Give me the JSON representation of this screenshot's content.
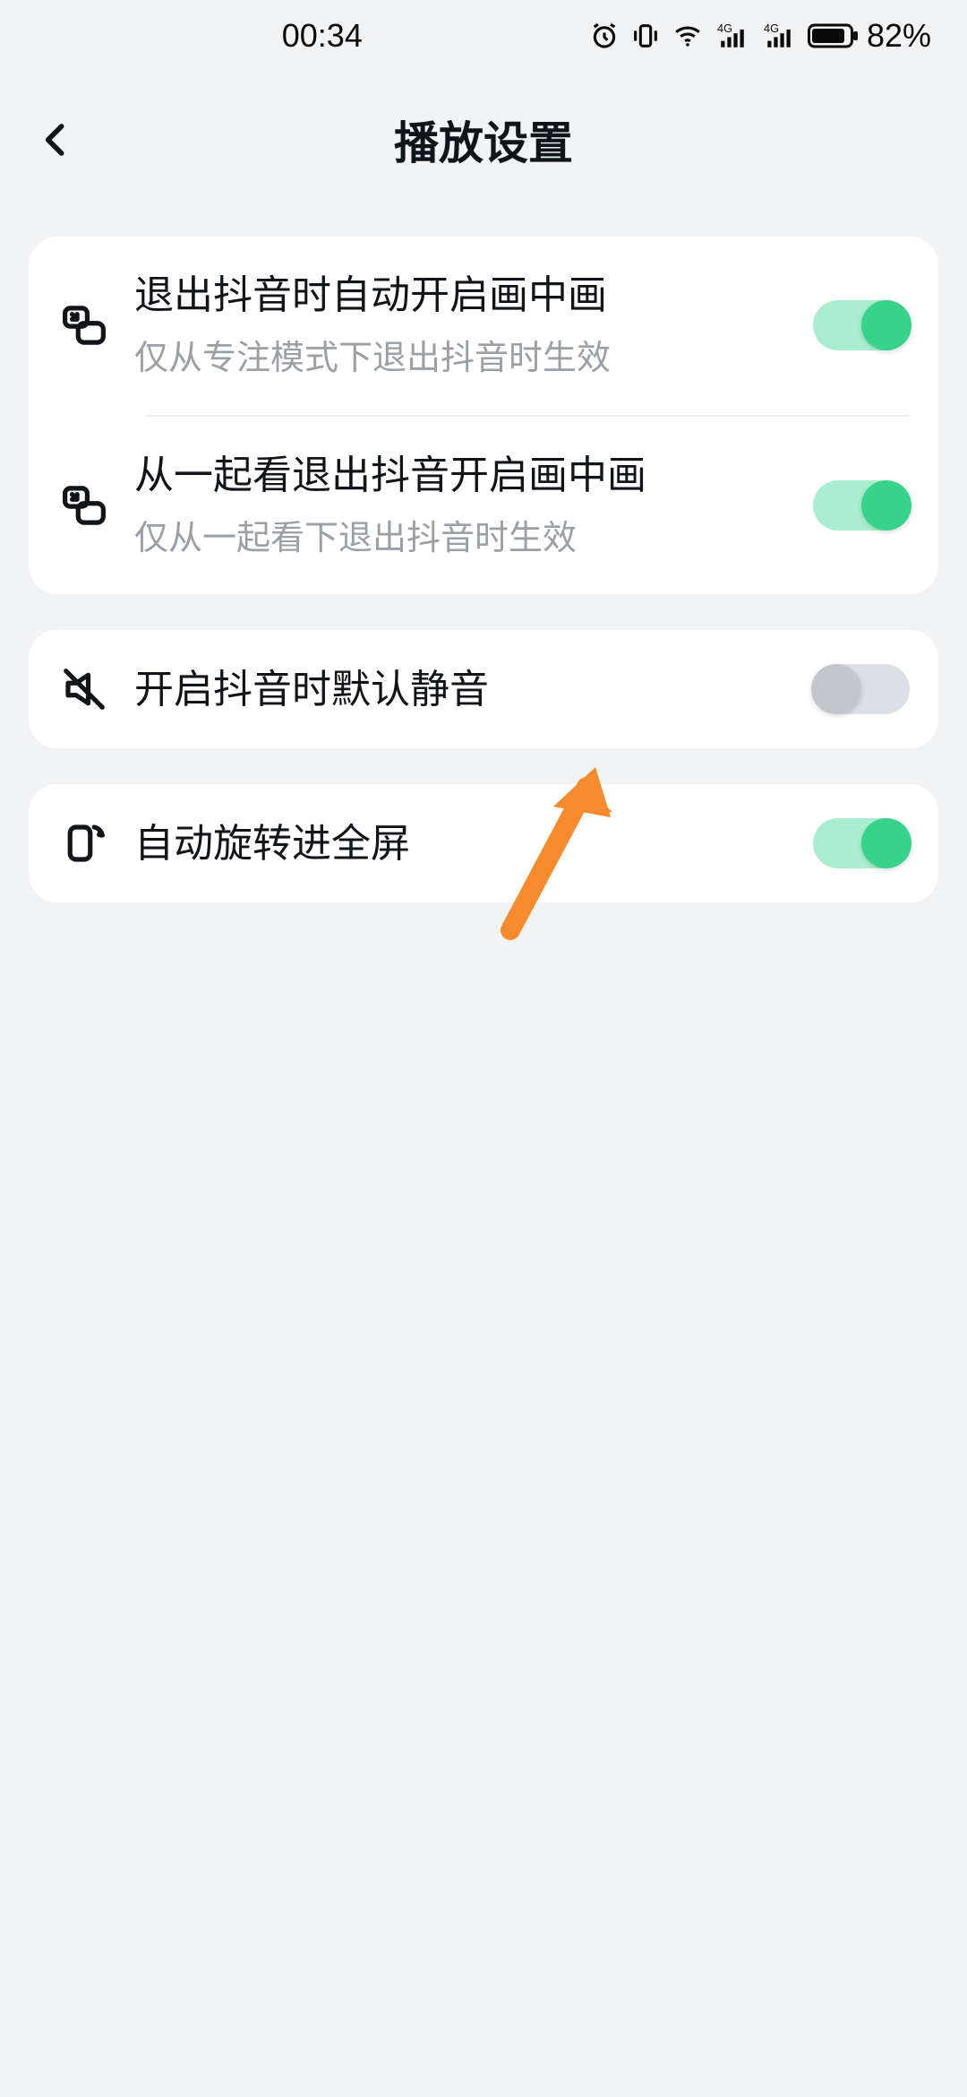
{
  "status": {
    "time": "00:34",
    "battery_text": "82%"
  },
  "header": {
    "title": "播放设置"
  },
  "groups": [
    {
      "rows": [
        {
          "id": "pip-on-exit",
          "icon": "pip-icon",
          "label": "退出抖音时自动开启画中画",
          "sub": "仅从专注模式下退出抖音时生效",
          "on": true
        },
        {
          "id": "pip-on-exit-watch-together",
          "icon": "pip-icon",
          "label": "从一起看退出抖音开启画中画",
          "sub": "仅从一起看下退出抖音时生效",
          "on": true
        }
      ]
    },
    {
      "rows": [
        {
          "id": "mute-on-launch",
          "icon": "mute-icon",
          "label": "开启抖音时默认静音",
          "on": false
        }
      ]
    },
    {
      "rows": [
        {
          "id": "auto-rotate-fullscreen",
          "icon": "rotate-icon",
          "label": "自动旋转进全屏",
          "on": true
        }
      ]
    }
  ],
  "annotation": {
    "points_to": "auto-rotate-fullscreen",
    "color": "#f78a2c"
  }
}
